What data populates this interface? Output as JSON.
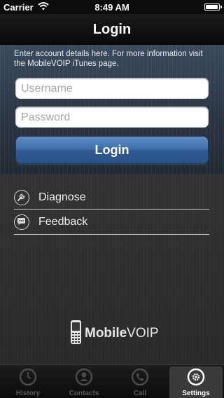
{
  "status_bar": {
    "carrier": "Carrier",
    "time": "8:49 AM",
    "battery_level": 0.95
  },
  "nav": {
    "title": "Login"
  },
  "login": {
    "info_text": "Enter account details here. For more information visit the MobileVOIP iTunes page.",
    "username_placeholder": "Username",
    "username_value": "",
    "password_placeholder": "Password",
    "password_value": "",
    "button_label": "Login"
  },
  "menu": {
    "items": [
      {
        "label": "Diagnose",
        "icon": "wrench-icon"
      },
      {
        "label": "Feedback",
        "icon": "speech-bubble-icon"
      }
    ]
  },
  "logo": {
    "text_bold": "Mobile",
    "text_regular": "VOIP"
  },
  "tab_bar": {
    "tabs": [
      {
        "label": "History",
        "icon": "clock-icon",
        "active": false
      },
      {
        "label": "Contacts",
        "icon": "person-icon",
        "active": false
      },
      {
        "label": "Call",
        "icon": "phone-icon",
        "active": false
      },
      {
        "label": "Settings",
        "icon": "gear-icon",
        "active": true
      }
    ]
  },
  "colors": {
    "accent_blue": "#3a6ca8",
    "header_blue": "#2b3644",
    "background": "#2a2a2a"
  }
}
